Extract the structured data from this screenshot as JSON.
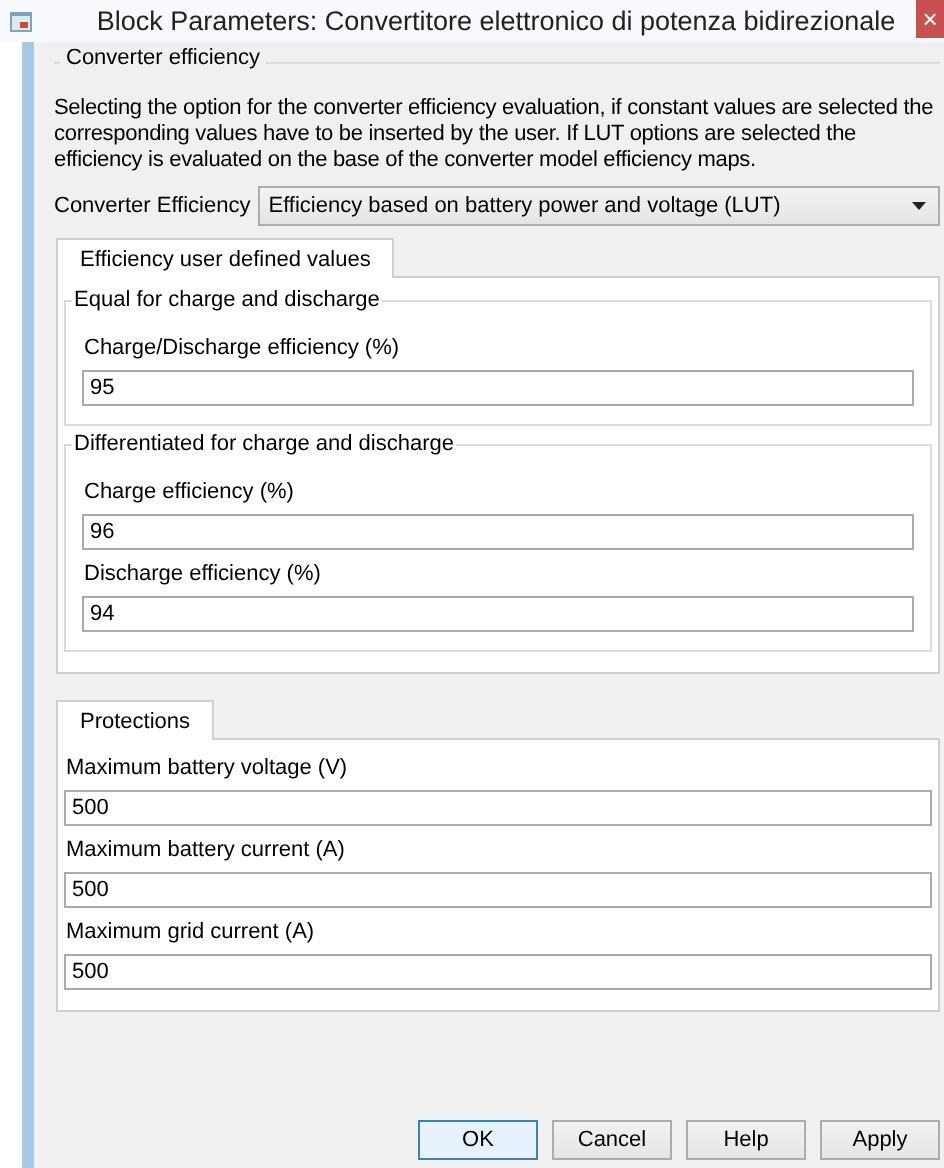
{
  "window": {
    "title": "Block Parameters: Convertitore elettronico di potenza bidirezionale",
    "close": "×"
  },
  "section": {
    "title": "Converter efficiency",
    "description": "Selecting the option for the converter efficiency evaluation, if constant values are selected the corresponding values have to be inserted by the user. If LUT options are selected the efficiency is evaluated on the base of the converter model efficiency maps.",
    "dropdown": {
      "label": "Converter Efficiency",
      "value": "Efficiency based on battery power and voltage (LUT)"
    }
  },
  "tab_panels": [
    {
      "tabs": [
        {
          "label": "Efficiency user defined values",
          "selected": true
        }
      ],
      "groups": [
        {
          "title": "Equal for charge and discharge",
          "fields": [
            {
              "label": "Charge/Discharge efficiency (%)",
              "value": "95"
            }
          ]
        },
        {
          "title": "Differentiated for charge and discharge",
          "fields": [
            {
              "label": "Charge efficiency (%)",
              "value": "96"
            },
            {
              "label": "Discharge efficiency (%)",
              "value": "94"
            }
          ]
        }
      ]
    },
    {
      "tabs": [
        {
          "label": "Protections",
          "selected": true
        }
      ],
      "fields": [
        {
          "label": "Maximum battery voltage (V)",
          "value": "500"
        },
        {
          "label": "Maximum battery current (A)",
          "value": "500"
        },
        {
          "label": "Maximum grid current (A)",
          "value": "500"
        }
      ]
    }
  ],
  "buttons": [
    {
      "label": "OK",
      "default": true
    },
    {
      "label": "Cancel",
      "default": false
    },
    {
      "label": "Help",
      "default": false
    },
    {
      "label": "Apply",
      "default": false
    }
  ]
}
